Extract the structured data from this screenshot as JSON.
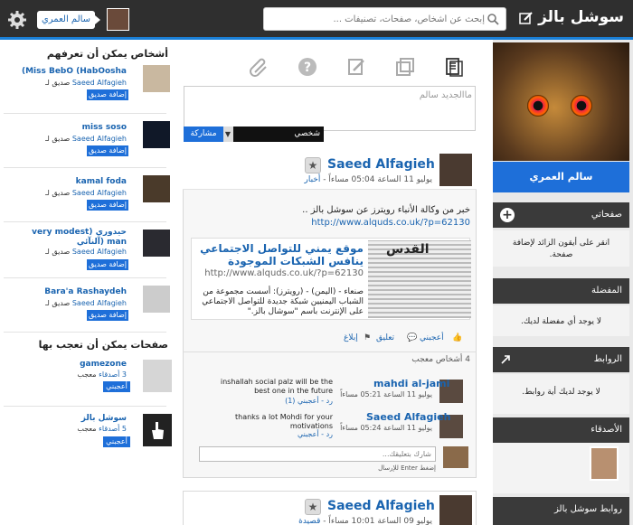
{
  "app": {
    "logo": "سوشل بالز"
  },
  "topbar": {
    "search_placeholder": "إبحث عن أشخاص، صفحات، تصنيفات ...",
    "user_name": "سالم العمري"
  },
  "profile": {
    "name": "سالم العمري"
  },
  "right_sections": [
    {
      "title": "صفحاتي",
      "body": "انقر على أيقون الزائد لإضافة صفحة."
    },
    {
      "title": "المفضلة",
      "body": "لا يوجد أي مفضلة لديك."
    },
    {
      "title": "الروابط",
      "body": "لا يوجد لديك أية روابط."
    },
    {
      "title": "الأصدقاء",
      "body": ""
    },
    {
      "title": "روابط سوشل بالز",
      "body": ""
    }
  ],
  "composer": {
    "placeholder": "ماالجديد سالم",
    "privacy": "شخصي",
    "share": "مشاركة"
  },
  "post1": {
    "author": "Saeed Alfagieh",
    "time": "يوليو 11 الساعة 05:04 مساءاً -",
    "category": "أخبار",
    "text": "خبر من وكالة الأنباء رويترز عن سوشل بالز ..",
    "url": "http://www.alquds.co.uk/?p=62130",
    "preview_title": "موقع يمني للتواصل الاجتماعي ينافس الشبكات الموجودة",
    "preview_url": "http://www.alquds.co.uk/?p=62130",
    "preview_desc": "صنعاء - (اليمن) - (رويترز): أسست مجموعة من الشباب اليمنيين شبكة جديدة للتواصل الاجتماعي على الإنترنت باسم \"سوشال بالز.\"",
    "masthead": "القدس",
    "actions": {
      "like": "أعجبني",
      "comment": "تعليق",
      "report": "إبلاغ"
    },
    "likes": "4 أشخاص معجب",
    "comments": [
      {
        "name": "mahdi al-jami",
        "time": "يوليو 11 الساعة 05:21 مساءاً",
        "text": "inshallah social palz will be the best one in the future",
        "reply": "رد - أعجبني (1)"
      },
      {
        "name": "Saeed Alfagieh",
        "time": "يوليو 11 الساعة 05:24 مساءاً",
        "text": "thanks a lot Mohdi for your motivations",
        "reply": "رد - أعجبني"
      }
    ],
    "comment_placeholder": "شارك بتعليقك...",
    "comment_hint": "إضغط Enter للإرسال"
  },
  "post2": {
    "author": "Saeed Alfagieh",
    "time": "يوليو 09 الساعة 10:01 مساءاً -",
    "category": "قصيدة"
  },
  "people": {
    "title": "أشخاص يمكن أن تعرفهم",
    "items": [
      {
        "name": "(Miss BebO (HabOosha",
        "sub_prefix": "صديق لـ",
        "sub_link": "Saeed Alfagieh",
        "button": "إضافة صديق"
      },
      {
        "name": "miss soso",
        "sub_prefix": "صديق لـ",
        "sub_link": "Saeed Alfagieh",
        "button": "إضافة صديق"
      },
      {
        "name": "kamal foda",
        "sub_prefix": "صديق لـ",
        "sub_link": "Saeed Alfagieh",
        "button": "إضافة صديق"
      },
      {
        "name": "very modest) ﺣﻴﺪﻭﺭﻱ ﺁﻟﻨﺂﺋﻲ) man",
        "sub_prefix": "صديق لـ",
        "sub_link": "Saeed Alfagieh",
        "button": "إضافة صديق"
      },
      {
        "name": "Bara'a Rashaydeh",
        "sub_prefix": "صديق لـ",
        "sub_link": "Saeed Alfagieh",
        "button": "إضافة صديق"
      }
    ]
  },
  "pages": {
    "title": "صفحات يمكن أن تعجب بها",
    "items": [
      {
        "name": "gamezone",
        "count": "3 أصدقاء",
        "suffix": "معجب",
        "button": "أعجبني"
      },
      {
        "name": "سوشل بالز",
        "count": "5 أصدقاء",
        "suffix": "معجب",
        "button": "أعجبني"
      }
    ]
  },
  "colors": {
    "topbar": "#2f2f2f",
    "accent": "#1e6fd9",
    "link": "#1a64b0"
  }
}
